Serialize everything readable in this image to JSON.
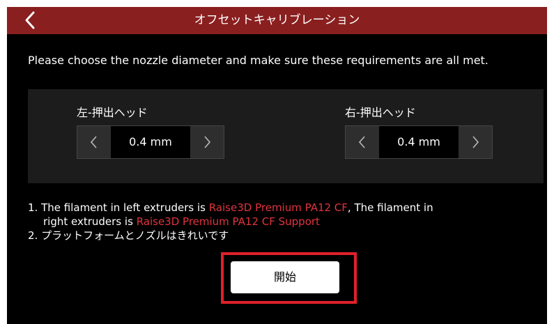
{
  "header": {
    "title": "オフセットキャリブレーション",
    "back_icon": "chevron-left-icon"
  },
  "intro_text": "Please choose the nozzle diameter and make sure these requirements are all met.",
  "left_extruder": {
    "label": "左-押出ヘッド",
    "value": "0.4 mm",
    "decrement_icon": "chevron-left-icon",
    "increment_icon": "chevron-right-icon"
  },
  "right_extruder": {
    "label": "右-押出ヘッド",
    "value": "0.4 mm",
    "decrement_icon": "chevron-left-icon",
    "increment_icon": "chevron-right-icon"
  },
  "requirements": {
    "item1": {
      "number": "1.",
      "text_a": "The filament in left extruders is",
      "filament_left": "Raise3D Premium PA12 CF",
      "text_b": ", The filament in",
      "text_c": "right extruders is",
      "filament_right": "Raise3D Premium PA12 CF Support"
    },
    "item2": {
      "number": "2.",
      "text": "プラットフォームとノズルはきれいです"
    }
  },
  "start_button": {
    "label": "開始"
  },
  "colors": {
    "title_bar": "#8a1f1f",
    "background": "#000000",
    "panel": "#1c1c1c",
    "highlight_text": "#e0343f",
    "annotation_frame": "#e0202a"
  }
}
